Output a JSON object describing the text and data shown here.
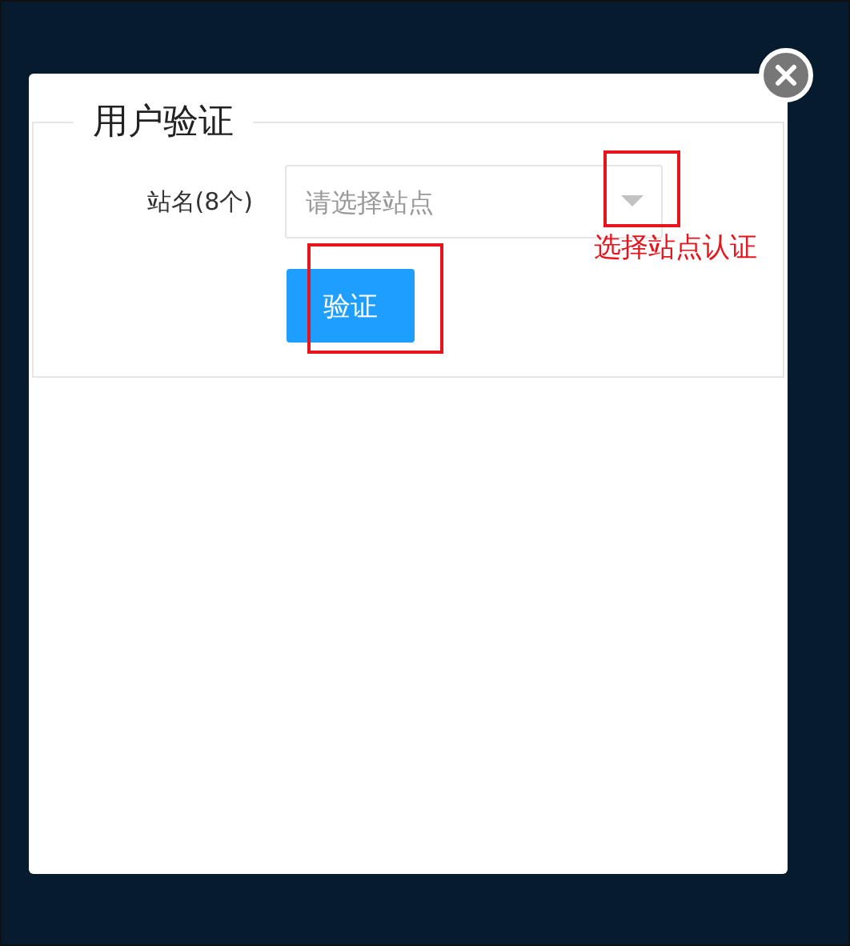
{
  "dialog": {
    "title": "用户验证",
    "fields": [
      {
        "label": "站名(8个)",
        "placeholder": "请选择站点"
      }
    ],
    "buttons": [
      "验证"
    ]
  },
  "annotation": {
    "note": "选择站点认证"
  }
}
